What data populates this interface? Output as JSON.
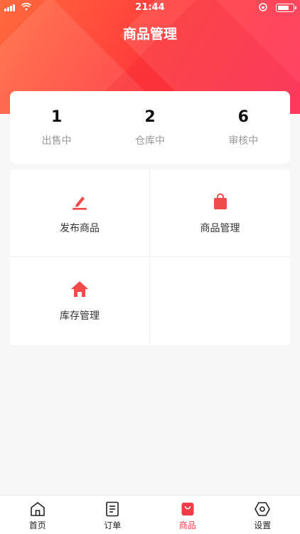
{
  "status_bar": {
    "time": "21:44"
  },
  "header": {
    "title": "商品管理"
  },
  "stats": [
    {
      "value": "1",
      "label": "出售中"
    },
    {
      "value": "2",
      "label": "仓库中"
    },
    {
      "value": "6",
      "label": "审核中"
    }
  ],
  "menu": {
    "publish": {
      "label": "发布商品",
      "icon": "edit-pen-icon"
    },
    "manage": {
      "label": "商品管理",
      "icon": "shopping-bag-icon"
    },
    "inventory": {
      "label": "库存管理",
      "icon": "house-icon"
    }
  },
  "tabs": [
    {
      "label": "首页",
      "icon": "home-icon",
      "active": false
    },
    {
      "label": "订单",
      "icon": "order-list-icon",
      "active": false
    },
    {
      "label": "商品",
      "icon": "goods-bag-icon",
      "active": true
    },
    {
      "label": "设置",
      "icon": "settings-hex-icon",
      "active": false
    }
  ],
  "colors": {
    "accent": "#f23b46",
    "header_start": "#ff6a3d",
    "header_end": "#ff2d55"
  }
}
